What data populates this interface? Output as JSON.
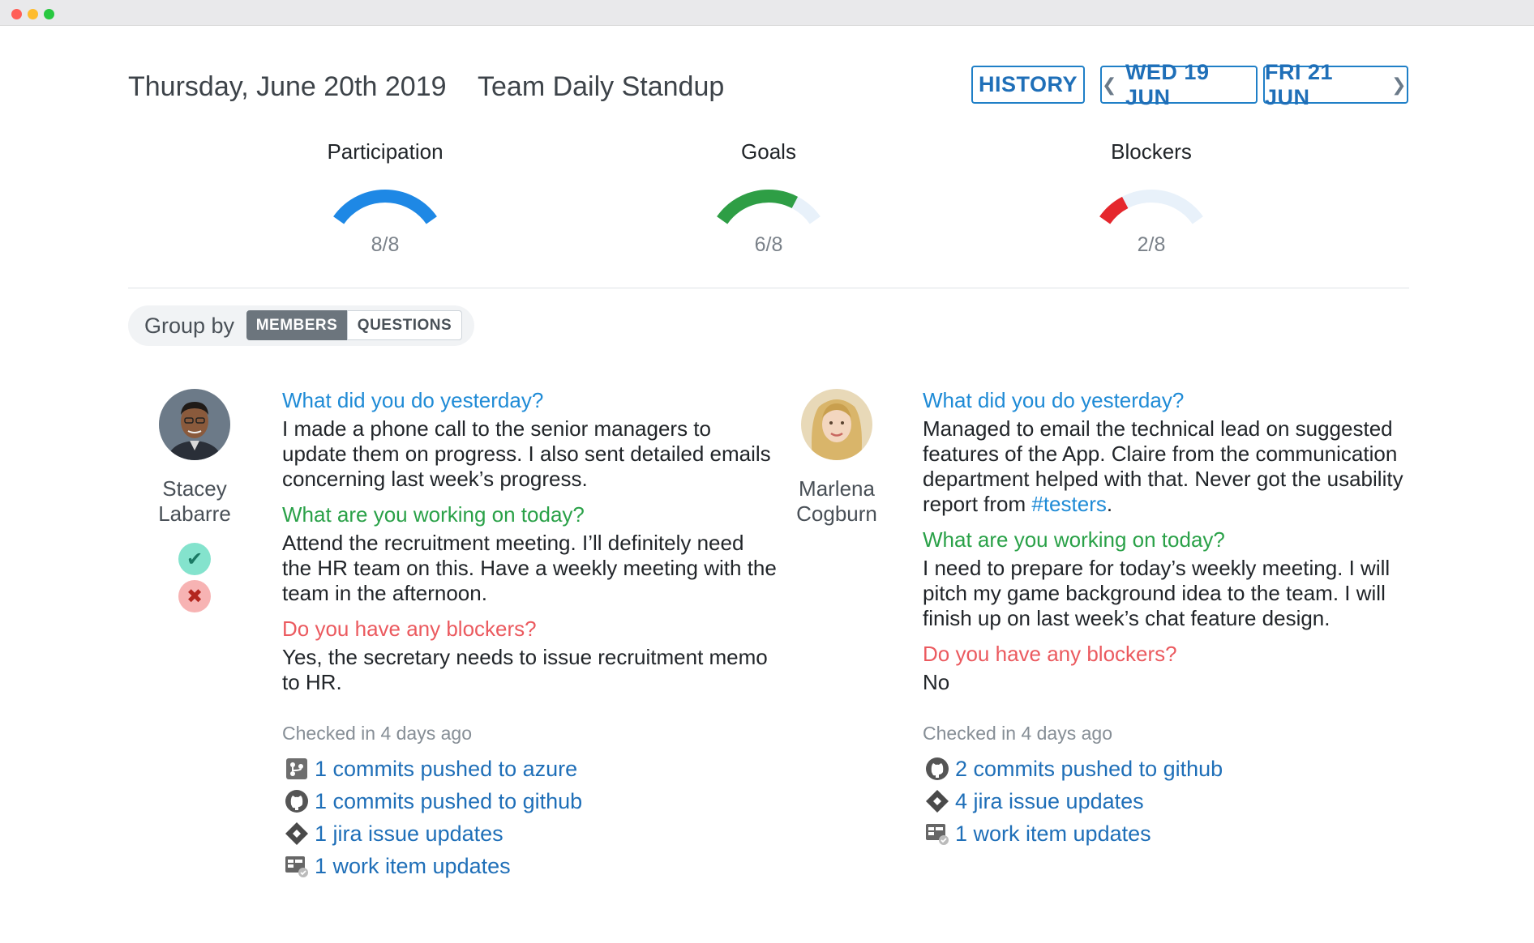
{
  "header": {
    "date": "Thursday, June 20th 2019",
    "meeting": "Team Daily Standup",
    "history_label": "HISTORY",
    "prev_label": "WED 19 JUN",
    "next_label": "FRI 21 JUN"
  },
  "gauges": [
    {
      "title": "Participation",
      "value": "8/8",
      "fraction": 1.0,
      "color": "#1e88e5"
    },
    {
      "title": "Goals",
      "value": "6/8",
      "fraction": 0.75,
      "color": "#2e9e45"
    },
    {
      "title": "Blockers",
      "value": "2/8",
      "fraction": 0.25,
      "color": "#e5272d"
    }
  ],
  "gauge_track_color": "#e8f1fa",
  "group_by": {
    "label": "Group by",
    "options": [
      "MEMBERS",
      "QUESTIONS"
    ],
    "selected": "MEMBERS"
  },
  "members": [
    {
      "name_line1": "Stacey",
      "name_line2": "Labarre",
      "status_icons": [
        "check-icon",
        "cross-icon"
      ],
      "q1": "What did you do yesterday?",
      "a1": "I made a phone call to the senior managers to update them on progress. I also sent detailed emails concerning last week’s progress.",
      "q2": "What are you working on today?",
      "a2": "Attend the recruitment meeting. I’ll definitely need the HR team on this. Have a weekly meeting with the team in the afternoon.",
      "q3": "Do you have any blockers?",
      "a3": "Yes, the secretary needs to issue recruitment memo to HR.",
      "checked": "Checked in 4 days ago",
      "activity": [
        {
          "icon": "azure-repos-icon",
          "text": "1 commits pushed to azure"
        },
        {
          "icon": "github-icon",
          "text": "1 commits pushed to github"
        },
        {
          "icon": "jira-icon",
          "text": "1 jira issue updates"
        },
        {
          "icon": "work-item-icon",
          "text": "1 work item updates"
        }
      ]
    },
    {
      "name_line1": "Marlena",
      "name_line2": "Cogburn",
      "q1": "What did you do yesterday?",
      "a1_text": "Managed to email the technical lead on suggested features of the App. Claire from the communication department helped with that. Never got the usability report from ",
      "a1_tag": "#testers",
      "a1_end": ".",
      "q2": "What are you working on today?",
      "a2": "I need to prepare for today’s weekly meeting. I will pitch my game background idea to the team. I will finish up on last week’s chat feature design.",
      "q3": "Do you have any blockers?",
      "a3": "No",
      "checked": "Checked in 4 days ago",
      "activity": [
        {
          "icon": "github-icon",
          "text": "2 commits pushed to github"
        },
        {
          "icon": "jira-icon",
          "text": "4 jira issue updates"
        },
        {
          "icon": "work-item-icon",
          "text": "1 work item updates"
        }
      ]
    }
  ]
}
